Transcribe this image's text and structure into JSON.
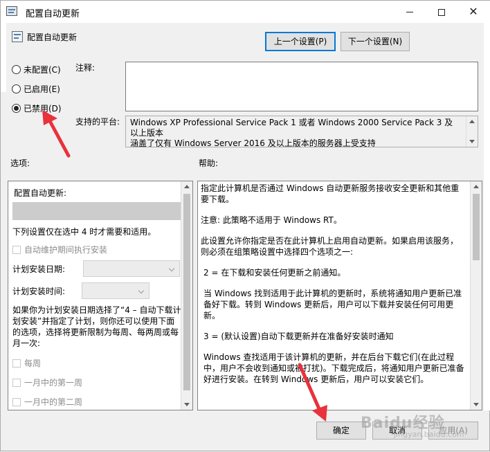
{
  "window": {
    "title": "配置自动更新"
  },
  "header": {
    "policy_title": "配置自动更新",
    "prev_button": "上一个设置(P)",
    "next_button": "下一个设置(N)"
  },
  "state": {
    "options": [
      {
        "label": "未配置(C)",
        "selected": false
      },
      {
        "label": "已启用(E)",
        "selected": false
      },
      {
        "label": "已禁用(D)",
        "selected": true
      }
    ]
  },
  "comment": {
    "label": "注释:",
    "value": ""
  },
  "platform": {
    "label": "支持的平台:",
    "text": "Windows XP Professional Service Pack 1 或者 Windows 2000 Service Pack 3 及以上版本",
    "text_cut": "涵盖了仅有 Windows Server 2016 及以上版本的服务器上受支持"
  },
  "options_section": {
    "label": "选项:",
    "title": "配置自动更新:",
    "note": "下列设置仅在选中 4 时才需要和适用。",
    "checkbox_maintenance": "自动维护期间执行安装",
    "schedule_day_label": "计划安装日期:",
    "schedule_time_label": "计划安装时间:",
    "paragraph": "如果你为计划安装日期选择了“4 – 自动下载计划安装”并指定了计划，则你还可以使用下面的选项，选择将更新限制为每周、每两周或每月一次:",
    "checkbox_weekly": "每周",
    "checkbox_first_week": "一月中的第一周",
    "checkbox_second_week": "一月中的第二周"
  },
  "help_section": {
    "label": "帮助:",
    "paragraphs": [
      "指定此计算机是否通过 Windows 自动更新服务接收安全更新和其他重要下载。",
      "注意: 此策略不适用于 Windows RT。",
      "此设置允许你指定是否在此计算机上启用自动更新。如果启用该服务，则必须在组策略设置中选择四个选项之一:",
      "2 = 在下载和安装任何更新之前通知。",
      "当 Windows 找到适用于此计算机的更新时，系统将通知用户更新已准备好下载。转到 Windows 更新后，用户可以下载并安装任何可用更新。",
      "3 = (默认设置)自动下载更新并在准备好安装时通知",
      "Windows 查找适用于该计算机的更新，并在后台下载它们(在此过程中，用户不会收到通知或被打扰)。下载完成后，将通知用户更新已准备好进行安装。在转到 Windows 更新后，用户可以安装它们。"
    ]
  },
  "footer": {
    "ok_button": "确定",
    "cancel_button": "取消",
    "apply_button": "应用(A)"
  },
  "watermark": {
    "text": "Baidu经验",
    "sub": "jingyan.baidu.com"
  },
  "colors": {
    "annotation_arrow": "#e8323c",
    "focus_border": "#0078d7"
  }
}
